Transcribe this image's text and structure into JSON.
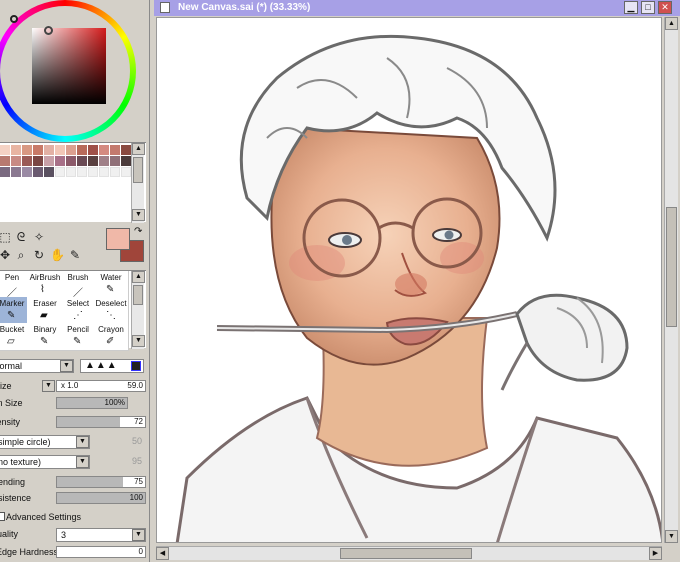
{
  "window": {
    "title": "New Canvas.sai (*) (33.33%)",
    "buttons": {
      "minimize": "▁",
      "restore": "□",
      "close": "✕"
    }
  },
  "colors": {
    "foreground": "#f0b8a8",
    "background": "#a0453a",
    "title_bar": "#a7a0e6",
    "selected_tool": "#9db4d8"
  },
  "swatches": [
    "#f4d2c4",
    "#e8b4a2",
    "#d89882",
    "#c87a68",
    "#e2b0a4",
    "#f2c6b6",
    "#dca090",
    "#b86a5a",
    "#a05048",
    "#d48a80",
    "#c47a6e",
    "#8a4a40",
    "#b87a70",
    "#c88a84",
    "#9a5a56",
    "#7a4644",
    "#c8a0a8",
    "#a87088",
    "#8c5a6a",
    "#6a4a54",
    "#5a4040",
    "#a08088",
    "#907078",
    "#4a3a3a",
    "#7a6a80",
    "#8a7890",
    "#9a8aa4",
    "#6a5a70",
    "#5a5060",
    null,
    null,
    null,
    null,
    null,
    null,
    null
  ],
  "tool_icons": [
    "select-rect-icon",
    "lasso-icon",
    "magic-wand-icon",
    "move-icon",
    "zoom-icon",
    "rotate-icon",
    "hand-icon",
    "eyedropper-icon"
  ],
  "brushes": [
    {
      "label": "Pen",
      "selected": false
    },
    {
      "label": "AirBrush",
      "selected": false
    },
    {
      "label": "Brush",
      "selected": false
    },
    {
      "label": "Water",
      "selected": false
    },
    {
      "label": "Marker",
      "selected": true
    },
    {
      "label": "Eraser",
      "selected": false
    },
    {
      "label": "Select",
      "selected": false
    },
    {
      "label": "Deselect",
      "selected": false
    },
    {
      "label": "Bucket",
      "selected": false
    },
    {
      "label": "Binary",
      "selected": false
    },
    {
      "label": "Pencil",
      "selected": false
    },
    {
      "label": "Crayon",
      "selected": false
    }
  ],
  "settings": {
    "blend_mode": "Normal",
    "size_label": "Size",
    "size_multiplier": "x 1.0",
    "size_value": "59.0",
    "min_size_label": "Min Size",
    "min_size_value": "100%",
    "min_size_fraction": 1.0,
    "density_label": "Density",
    "density_value": "72",
    "density_fraction": 0.72,
    "shape": "(simple circle)",
    "shape_value": "50",
    "texture": "(no texture)",
    "texture_value": "95",
    "blending_label": "Blending",
    "blending_value": "75",
    "blending_fraction": 0.75,
    "persistence_label": "Persistence",
    "persistence_value": "100",
    "persistence_fraction": 1.0,
    "advanced_label": "Advanced Settings",
    "quality_label": "Quality",
    "quality_value": "3",
    "edge_hardness_label": "Edge Hardness",
    "edge_hardness_value": "0",
    "edge_hardness_fraction": 0.0
  }
}
